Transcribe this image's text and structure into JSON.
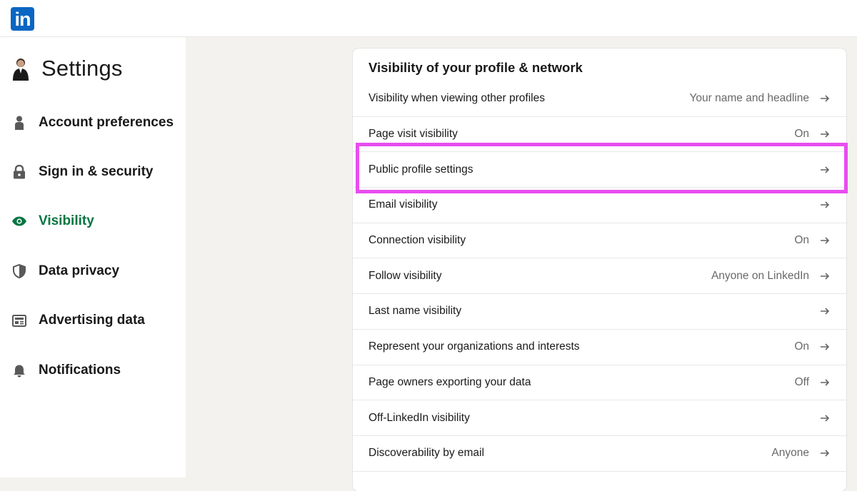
{
  "topbar": {
    "logo_text": "in",
    "logo_color": "#0a66c2"
  },
  "sidebar": {
    "title": "Settings",
    "items": [
      {
        "label": "Account preferences",
        "icon": "person-icon",
        "active": false
      },
      {
        "label": "Sign in & security",
        "icon": "lock-icon",
        "active": false
      },
      {
        "label": "Visibility",
        "icon": "eye-icon",
        "active": true
      },
      {
        "label": "Data privacy",
        "icon": "shield-icon",
        "active": false
      },
      {
        "label": "Advertising data",
        "icon": "newspaper-icon",
        "active": false
      },
      {
        "label": "Notifications",
        "icon": "bell-icon",
        "active": false
      }
    ],
    "active_color": "#057642"
  },
  "main": {
    "section_title": "Visibility of your profile & network",
    "rows": [
      {
        "label": "Visibility when viewing other profiles",
        "value": "Your name and headline"
      },
      {
        "label": "Page visit visibility",
        "value": "On"
      },
      {
        "label": "Public profile settings",
        "value": ""
      },
      {
        "label": "Email visibility",
        "value": ""
      },
      {
        "label": "Connection visibility",
        "value": "On"
      },
      {
        "label": "Follow visibility",
        "value": "Anyone on LinkedIn"
      },
      {
        "label": "Last name visibility",
        "value": ""
      },
      {
        "label": "Represent your organizations and interests",
        "value": "On"
      },
      {
        "label": "Page owners exporting your data",
        "value": "Off"
      },
      {
        "label": "Off-LinkedIn visibility",
        "value": ""
      },
      {
        "label": "Discoverability by email",
        "value": "Anyone"
      }
    ]
  },
  "highlight": {
    "target": "Public profile settings",
    "color": "#e84df0"
  }
}
